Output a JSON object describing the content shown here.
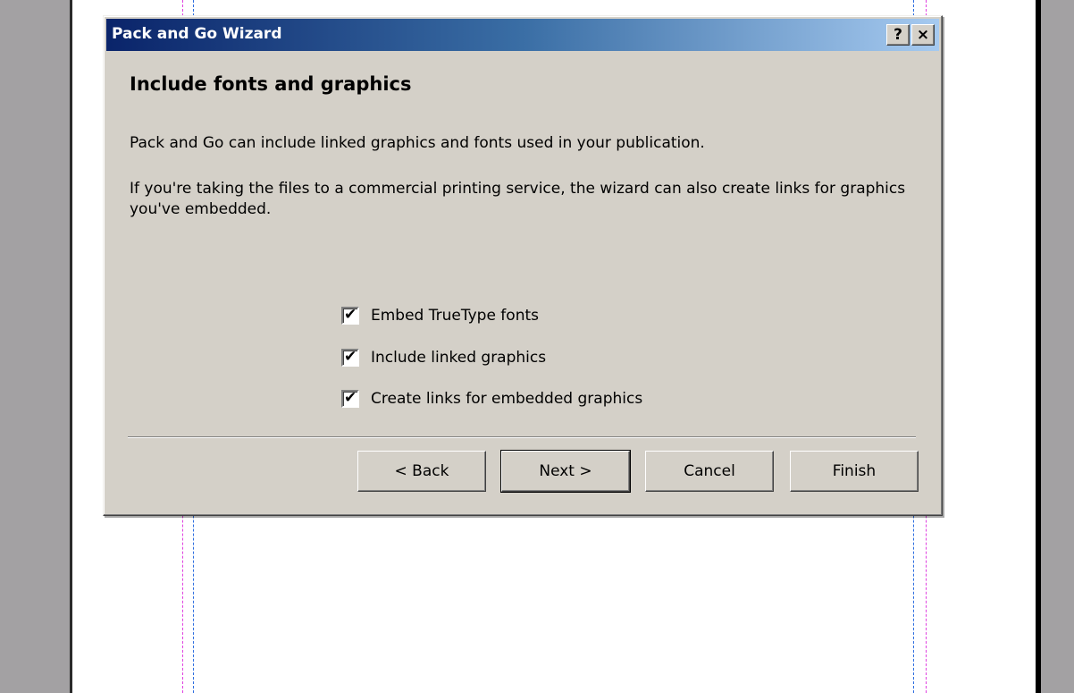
{
  "dialog": {
    "title": "Pack and Go Wizard",
    "help_glyph": "?",
    "close_glyph": "×",
    "heading": "Include fonts and graphics",
    "paragraph1": "Pack and Go can include linked graphics and fonts used in your publication.",
    "paragraph2": "If you're taking the files to a commercial printing service, the wizard can also create links for graphics you've embedded.",
    "options": [
      {
        "label": "Embed TrueType fonts",
        "checked": true
      },
      {
        "label": "Include linked graphics",
        "checked": true
      },
      {
        "label": "Create links for embedded graphics",
        "checked": true
      }
    ],
    "buttons": {
      "back": "< Back",
      "next": "Next >",
      "cancel": "Cancel",
      "finish": "Finish"
    }
  },
  "colors": {
    "title_gradient_start": "#0a246a",
    "title_gradient_end": "#a6caf0",
    "dialog_face": "#d4d0c8",
    "workspace_gray": "#a3a1a3",
    "guide_pink": "#e040e0",
    "guide_blue": "#2f6fe0"
  }
}
